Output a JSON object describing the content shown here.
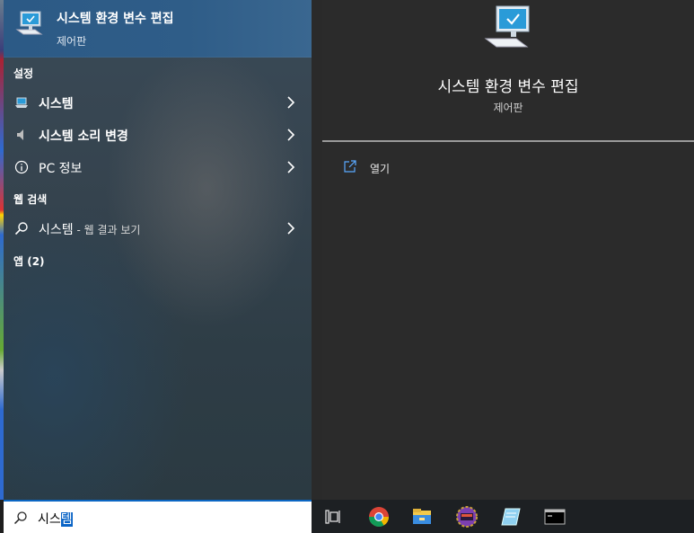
{
  "best_match": {
    "title": "시스템 환경 변수 편집",
    "subtitle": "제어판",
    "icon": "system-monitor-icon"
  },
  "sections": {
    "settings": "설정",
    "web": "웹 검색",
    "apps": "앱 (2)"
  },
  "settings_items": [
    {
      "label": "시스템",
      "icon": "laptop-icon"
    },
    {
      "label": "시스템 소리 변경",
      "icon": "speaker-icon"
    },
    {
      "label": "PC 정보",
      "icon": "info-icon"
    }
  ],
  "web_item": {
    "label": "시스템",
    "suffix": " - 웹 결과 보기",
    "icon": "search-icon"
  },
  "detail": {
    "title": "시스템 환경 변수 편집",
    "subtitle": "제어판",
    "open_label": "열기"
  },
  "search": {
    "typed": "시스",
    "selected": "템"
  },
  "taskbar_icons": [
    "task-view-icon",
    "chrome-icon",
    "file-explorer-icon",
    "game-icon",
    "notepad-icon",
    "terminal-icon"
  ],
  "colors": {
    "accent": "#0a64c6",
    "best_match_bg": "#2f5d88",
    "right_panel_bg": "#2b2b2b",
    "taskbar_bg": "#1d2023"
  }
}
